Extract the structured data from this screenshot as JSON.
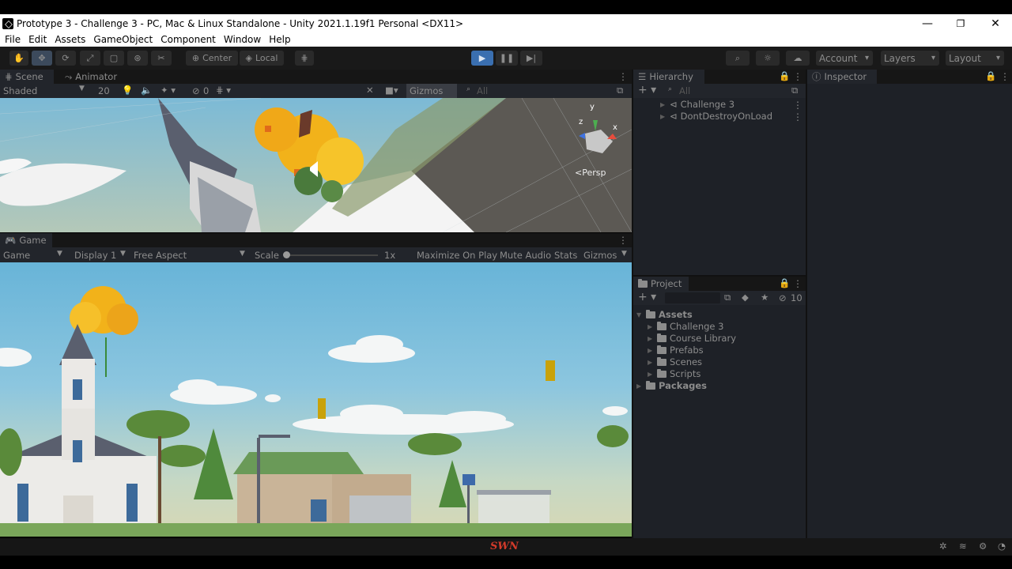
{
  "window": {
    "title": "Prototype 3 - Challenge 3 - PC, Mac & Linux Standalone - Unity 2021.1.19f1 Personal <DX11>",
    "controls": [
      "—",
      "❐",
      "✕"
    ]
  },
  "menu": [
    "File",
    "Edit",
    "Assets",
    "GameObject",
    "Component",
    "Window",
    "Help"
  ],
  "toolbar": {
    "tools": [
      "hand-tool",
      "move-tool",
      "rotate-tool",
      "scale-tool",
      "rect-tool",
      "transform-tool",
      "custom-tool"
    ],
    "pivot_center": "Center",
    "pivot_local": "Local",
    "account": "Account",
    "layers": "Layers",
    "layout": "Layout"
  },
  "scene": {
    "tabs": [
      "Scene",
      "Animator"
    ],
    "shading": "Shaded",
    "mode_2d": "20",
    "hidden_count": "0",
    "gizmos": "Gizmos",
    "search_placeholder": "All",
    "persp_label": "Persp",
    "axis_labels": {
      "y": "y",
      "x": "x",
      "z": "z"
    }
  },
  "game": {
    "tab": "Game",
    "mode": "Game",
    "display": "Display 1",
    "aspect": "Free Aspect",
    "scale_label": "Scale",
    "scale_value": "1x",
    "maximize": "Maximize On Play",
    "mute": "Mute Audio",
    "stats": "Stats",
    "gizmos": "Gizmos"
  },
  "hierarchy": {
    "tab": "Hierarchy",
    "search_placeholder": "All",
    "items": [
      "Challenge 3",
      "DontDestroyOnLoad"
    ]
  },
  "inspector": {
    "tab": "Inspector"
  },
  "project": {
    "tab": "Project",
    "hidden_count": "10",
    "root": "Assets",
    "folders": [
      "Challenge 3",
      "Course Library",
      "Prefabs",
      "Scenes",
      "Scripts"
    ],
    "packages": "Packages"
  },
  "watermark": "SWN",
  "colors": {
    "accent": "#3a6fb0",
    "watermark": "#d23a2a",
    "panel": "#1e2127"
  }
}
